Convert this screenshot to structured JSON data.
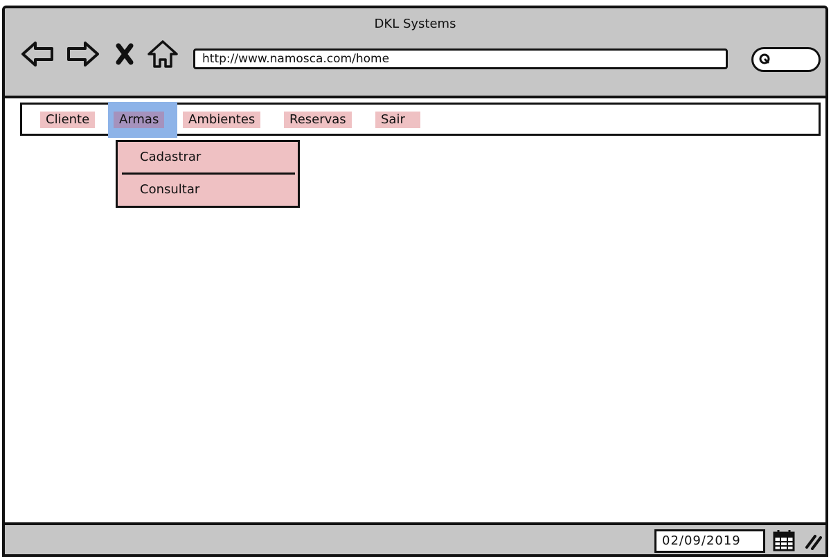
{
  "window": {
    "title": "DKL Systems"
  },
  "toolbar": {
    "back_icon": "back-arrow-icon",
    "forward_icon": "forward-arrow-icon",
    "stop_icon": "close-icon",
    "home_icon": "home-icon",
    "url": "http://www.namosca.com/home",
    "search_icon": "search-icon"
  },
  "menu": {
    "items": [
      {
        "label": "Cliente"
      },
      {
        "label": "Armas",
        "active": true
      },
      {
        "label": "Ambientes"
      },
      {
        "label": "Reservas"
      },
      {
        "label": "Sair"
      }
    ],
    "dropdown": [
      {
        "label": "Cadastrar"
      },
      {
        "label": "Consultar"
      }
    ]
  },
  "statusbar": {
    "date": "02/09/2019",
    "calendar_icon": "calendar-icon",
    "grip_icon": "resize-grip-icon"
  },
  "colors": {
    "chrome": "#c6c6c6",
    "menu_item": "#efc1c3",
    "active_highlight": "#8db3e8",
    "active_item": "#a592bd"
  }
}
